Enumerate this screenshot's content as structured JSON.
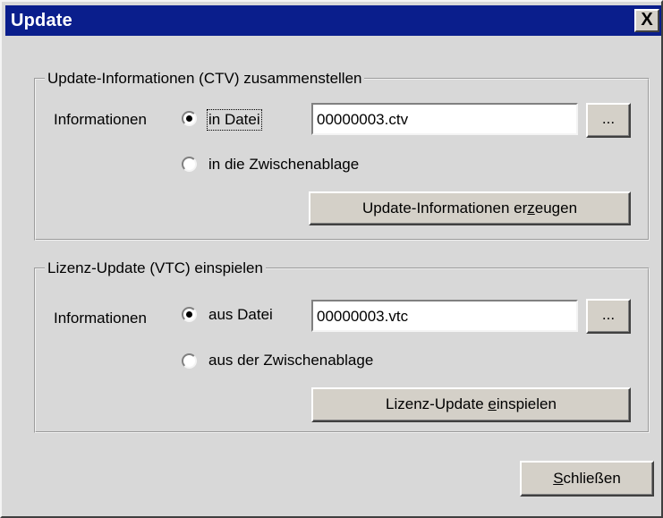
{
  "window": {
    "title": "Update",
    "close_label": "X"
  },
  "group_ctv": {
    "legend": "Update-Informationen (CTV) zusammenstellen",
    "info_label": "Informationen",
    "radio_file_label": "in Datei",
    "radio_file_checked": true,
    "radio_clipboard_label": "in die Zwischenablage",
    "radio_clipboard_checked": false,
    "file_value": "00000003.ctv",
    "browse_label": "...",
    "action_button": {
      "before": "Update-Informationen er",
      "mnemonic": "z",
      "after": "eugen"
    }
  },
  "group_vtc": {
    "legend": "Lizenz-Update (VTC) einspielen",
    "info_label": "Informationen",
    "radio_file_label": "aus Datei",
    "radio_file_checked": true,
    "radio_clipboard_label": "aus der Zwischenablage",
    "radio_clipboard_checked": false,
    "file_value": "00000003.vtc",
    "browse_label": "...",
    "action_button": {
      "before": "Lizenz-Update ",
      "mnemonic": "e",
      "after": "inspielen"
    }
  },
  "close_button": {
    "mnemonic": "S",
    "after": "chließen"
  }
}
